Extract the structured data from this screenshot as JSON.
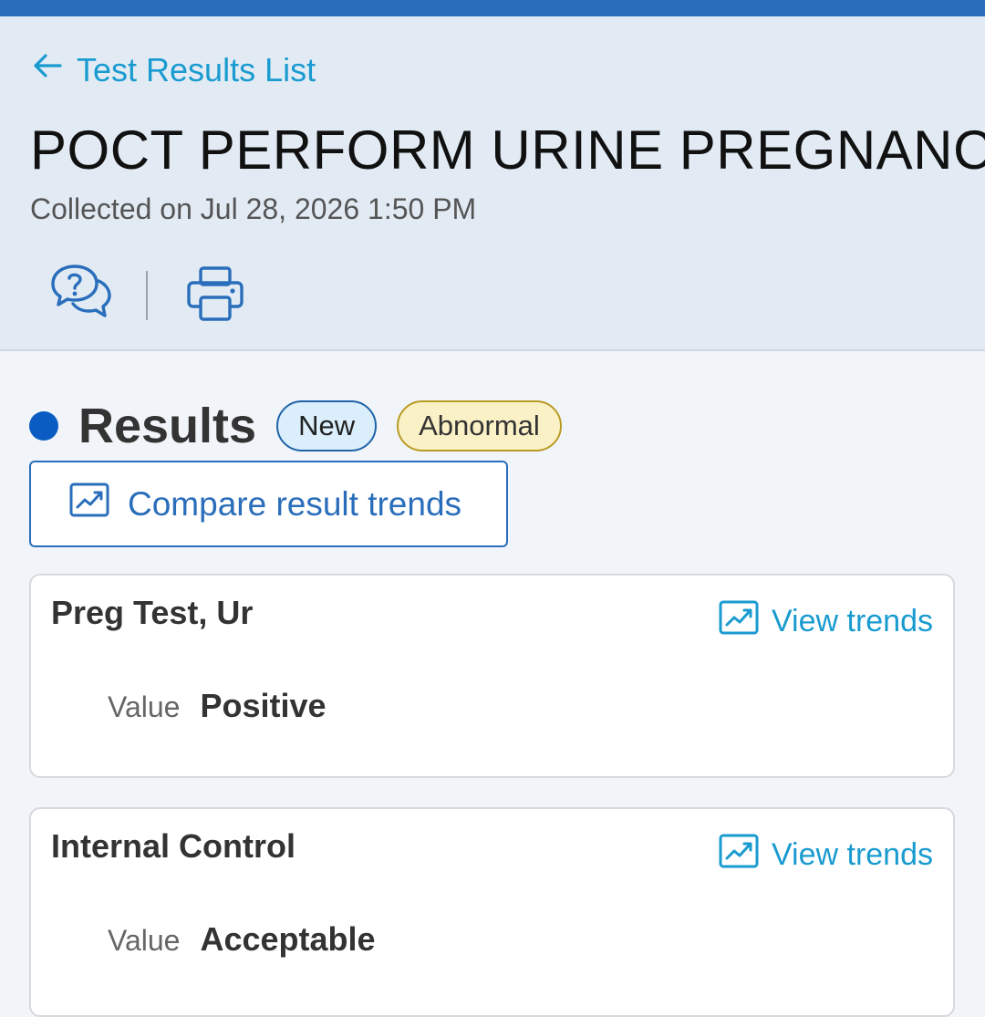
{
  "header": {
    "back_label": "Test Results List",
    "title": "POCT PERFORM URINE PREGNANCY",
    "collected": "Collected on Jul 28, 2026 1:50 PM",
    "actions": [
      {
        "icon": "question-chat-icon"
      },
      {
        "icon": "printer-icon"
      }
    ]
  },
  "results": {
    "heading": "Results",
    "badges": [
      "New",
      "Abnormal"
    ],
    "compare_label": "Compare result trends",
    "items": [
      {
        "name": "Preg Test, Ur",
        "trends_label": "View trends",
        "value_label": "Value",
        "value": "Positive"
      },
      {
        "name": "Internal Control",
        "trends_label": "View trends",
        "value_label": "Value",
        "value": "Acceptable"
      }
    ]
  },
  "colors": {
    "accent": "#2a6ebb",
    "link": "#1a9bd0",
    "header_bg": "#e2ebf4",
    "status_dot": "#0a5cc2",
    "abnormal_bg": "#fbf1c6"
  }
}
